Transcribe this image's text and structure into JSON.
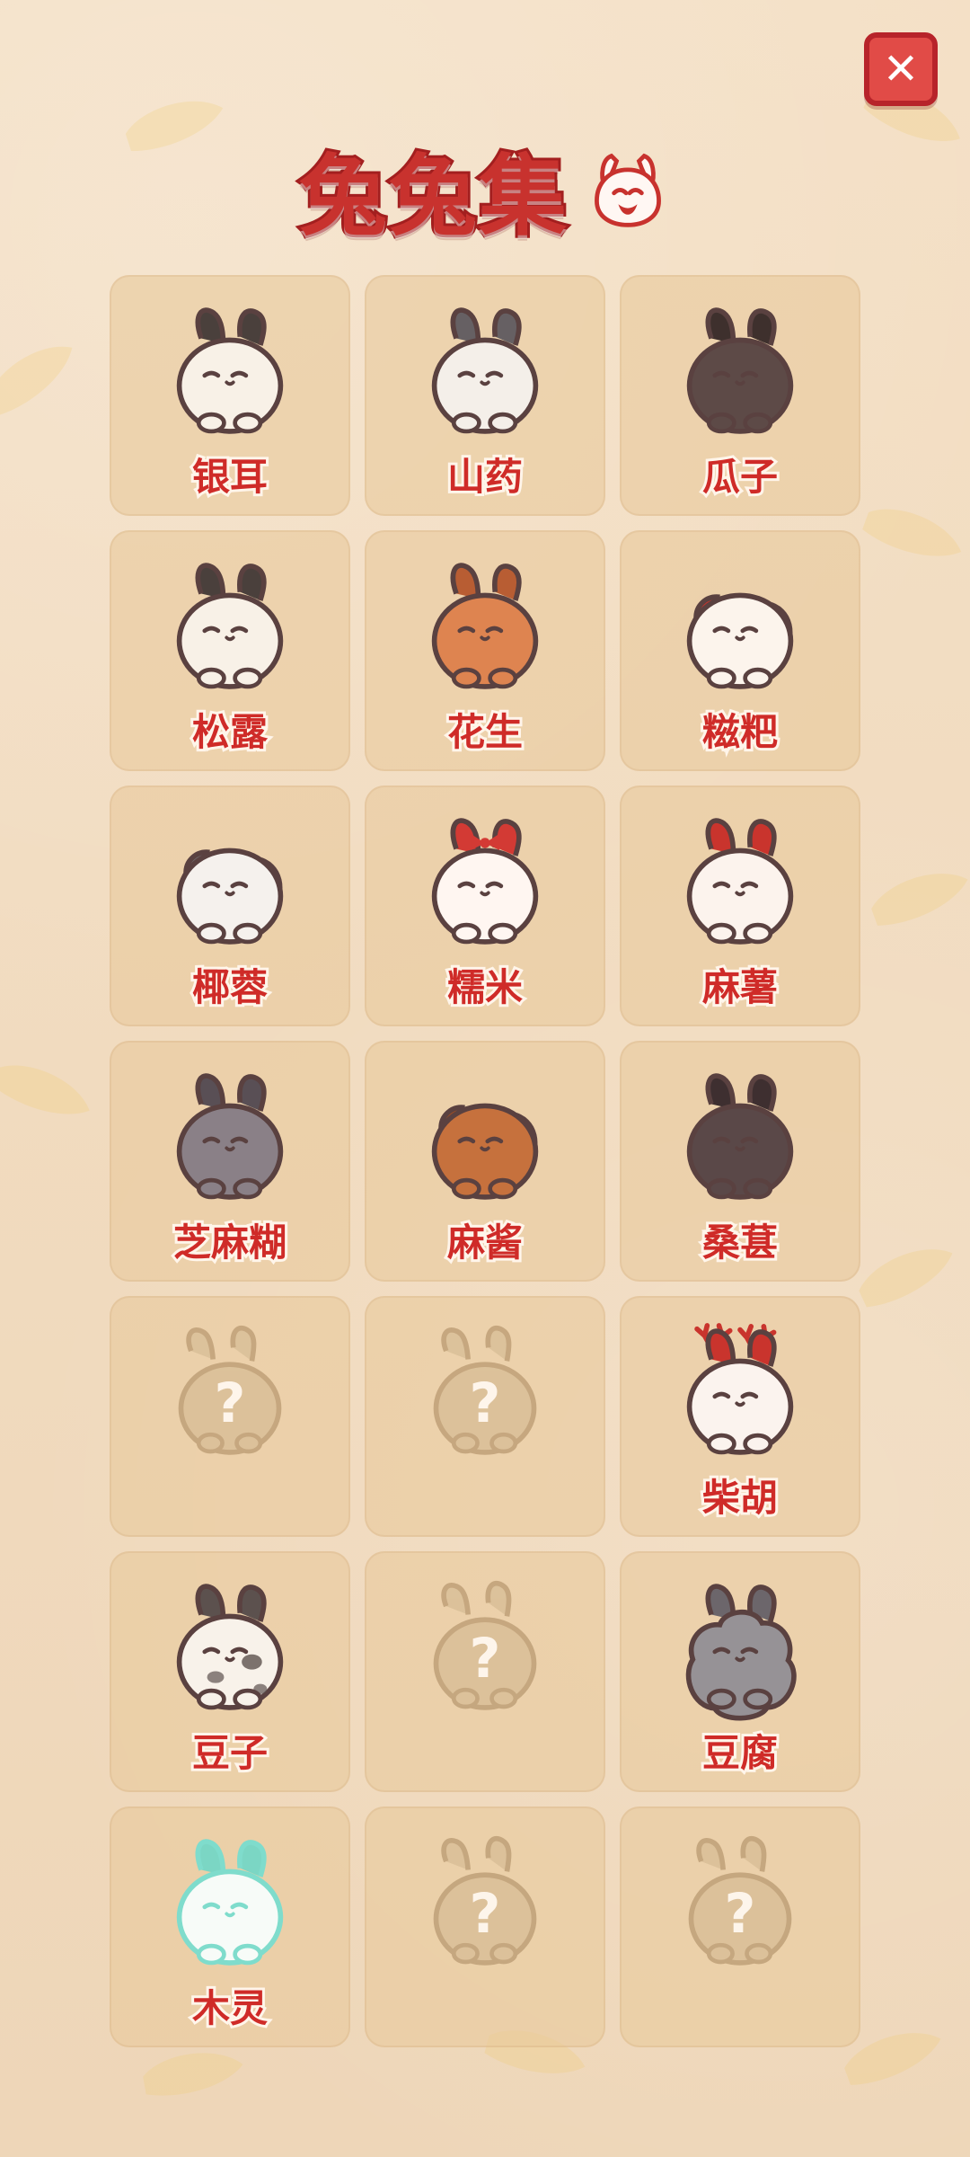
{
  "header": {
    "title": "兔兔集",
    "close_label": "✕"
  },
  "colors": {
    "title": "#c8322e",
    "name": "#cf2b28",
    "card_bg": "#e8c99d",
    "close": "#e14b47"
  },
  "grid": {
    "columns": 3,
    "items": [
      {
        "name": "银耳",
        "icon": "white-bunny-icon",
        "fur": "#f8f1e7",
        "accent": "#4a403c",
        "locked": false
      },
      {
        "name": "山药",
        "icon": "gray-white-bunny-icon",
        "fur": "#f4efe9",
        "accent": "#666063",
        "locked": false
      },
      {
        "name": "瓜子",
        "icon": "dark-brown-bunny-icon",
        "fur": "#5d4a47",
        "accent": "#3e302d",
        "locked": false
      },
      {
        "name": "松露",
        "icon": "black-eared-bunny-icon",
        "fur": "#f8f1e7",
        "accent": "#4a403c",
        "locked": false
      },
      {
        "name": "花生",
        "icon": "orange-bunny-icon",
        "fur": "#de8450",
        "accent": "#b85d33",
        "locked": false
      },
      {
        "name": "糍粑",
        "icon": "lop-eared-bunny-icon",
        "fur": "#fcf4ec",
        "accent": "#c9342d",
        "locked": false
      },
      {
        "name": "椰蓉",
        "icon": "gray-lop-bunny-icon",
        "fur": "#f5f1ed",
        "accent": "#6d6466",
        "locked": false
      },
      {
        "name": "糯米",
        "icon": "bow-bunny-icon",
        "fur": "#fff6f1",
        "accent": "#d33a34",
        "locked": false
      },
      {
        "name": "麻薯",
        "icon": "red-eared-bunny-icon",
        "fur": "#fcf3ed",
        "accent": "#c9342d",
        "locked": false
      },
      {
        "name": "芝麻糊",
        "icon": "gray-bunny-icon",
        "fur": "#8a8087",
        "accent": "#594f55",
        "locked": false
      },
      {
        "name": "麻酱",
        "icon": "brown-lop-bunny-icon",
        "fur": "#c6713d",
        "accent": "#9a4c25",
        "locked": false
      },
      {
        "name": "桑葚",
        "icon": "black-bunny-icon",
        "fur": "#5a4848",
        "accent": "#3e2f30",
        "locked": false
      },
      {
        "name": "",
        "icon": "mystery-bunny-icon",
        "locked": true
      },
      {
        "name": "",
        "icon": "mystery-bunny-icon",
        "locked": true
      },
      {
        "name": "柴胡",
        "icon": "antler-bunny-icon",
        "fur": "#fbf3ee",
        "accent": "#c9342d",
        "locked": false
      },
      {
        "name": "豆子",
        "icon": "spotted-bunny-icon",
        "fur": "#f8f2ea",
        "accent": "#5c514e",
        "locked": false
      },
      {
        "name": "",
        "icon": "mystery-bunny-icon",
        "locked": true
      },
      {
        "name": "豆腐",
        "icon": "gray-fluffy-bunny-icon",
        "fur": "#969296",
        "accent": "#6c666b",
        "locked": false
      },
      {
        "name": "木灵",
        "icon": "mint-bunny-icon",
        "fur": "#f7fbf8",
        "accent": "#7bd6c4",
        "locked": false
      },
      {
        "name": "",
        "icon": "mystery-bunny-icon",
        "locked": true
      },
      {
        "name": "",
        "icon": "mystery-bunny-icon",
        "locked": true
      }
    ]
  }
}
